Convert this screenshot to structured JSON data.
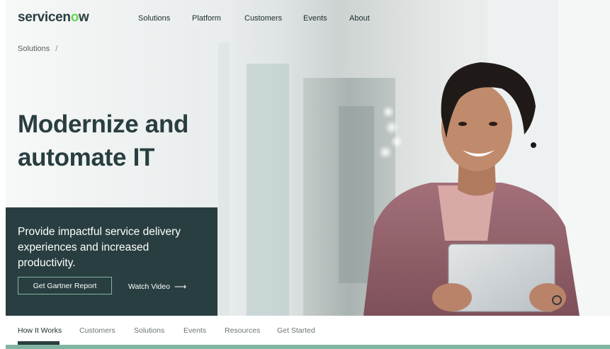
{
  "brand": {
    "logo_prefix": "servicen",
    "logo_accent": "o",
    "logo_suffix": "w"
  },
  "topnav": {
    "items": [
      {
        "label": "Solutions"
      },
      {
        "label": "Platform"
      },
      {
        "label": "Customers"
      },
      {
        "label": "Events"
      },
      {
        "label": "About"
      }
    ]
  },
  "breadcrumb": {
    "item": "Solutions",
    "separator": "/"
  },
  "hero": {
    "headline_line1": "Modernize and",
    "headline_line2": "automate IT",
    "promo_text": "Provide impactful service delivery experiences and increased productivity.",
    "primary_button": "Get Gartner Report",
    "video_link": "Watch Video",
    "video_arrow": "⟶"
  },
  "subnav": {
    "items": [
      {
        "label": "How It Works",
        "active": true
      },
      {
        "label": "Customers"
      },
      {
        "label": "Solutions"
      },
      {
        "label": "Events"
      },
      {
        "label": "Resources"
      },
      {
        "label": "Get Started"
      }
    ]
  },
  "colors": {
    "brand_dark": "#293e40",
    "brand_accent": "#62d84e",
    "sage": "#81b5a1"
  }
}
